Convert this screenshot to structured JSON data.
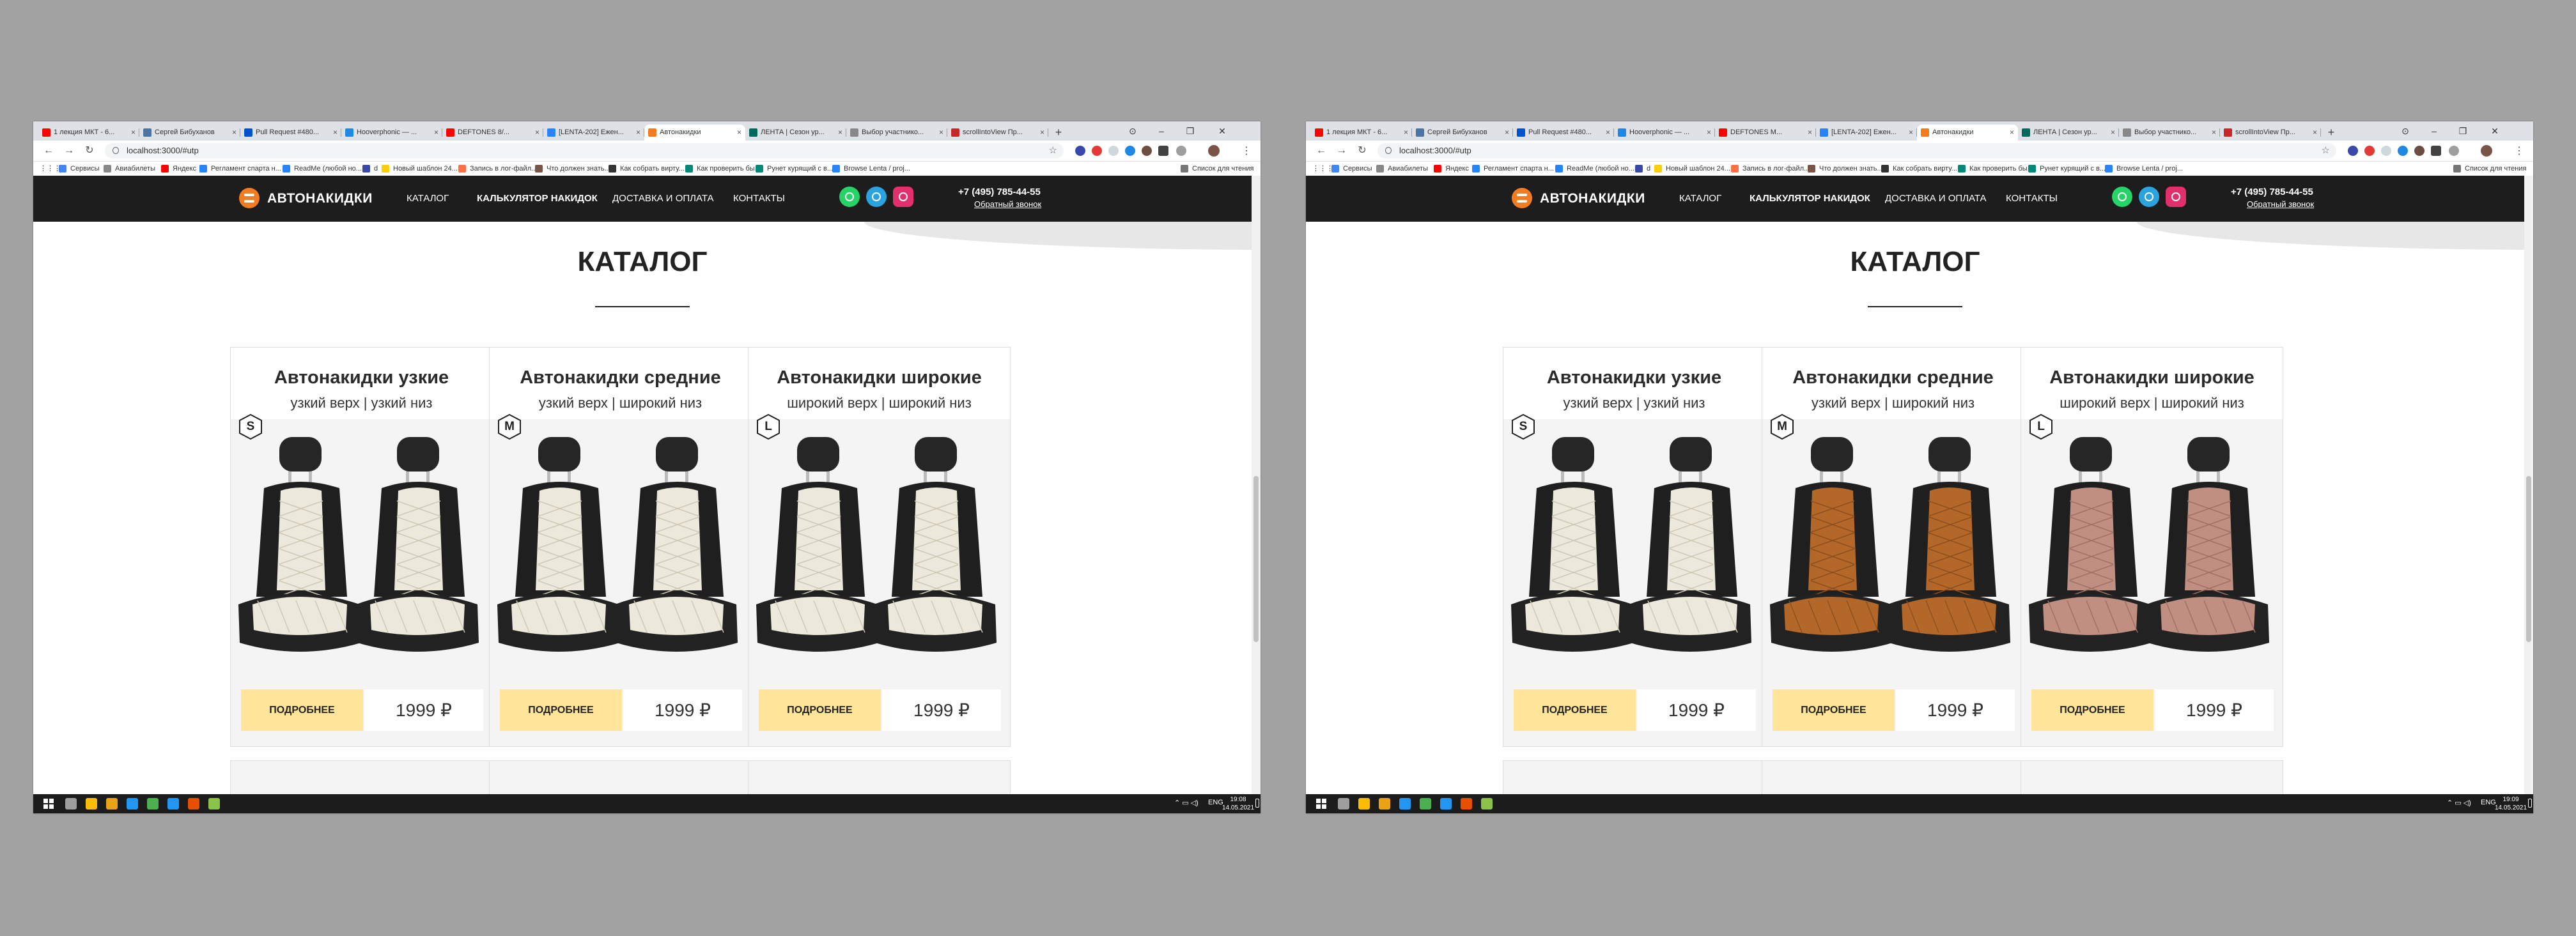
{
  "screens": [
    {
      "id": "left",
      "tabs": [
        {
          "title": "1 лекция МКТ - 6...",
          "fav": "#ff0000"
        },
        {
          "title": "Сергей Бибуханов",
          "fav": "#4c75a3"
        },
        {
          "title": "Pull Request #480...",
          "fav": "#0052cc"
        },
        {
          "title": "Hooverphonic — ...",
          "fav": "#1e88e5"
        },
        {
          "title": "DEFTONES 8/...",
          "fav": "#ff0000"
        },
        {
          "title": "[LENTA-202] Ежен...",
          "fav": "#2684ff"
        },
        {
          "title": "Автонакидки",
          "fav": "#f27c21",
          "active": true
        },
        {
          "title": "ЛЕНТА | Сезон ур...",
          "fav": "#00695c"
        },
        {
          "title": "Выбор участнико...",
          "fav": "#888888"
        },
        {
          "title": "scrollIntoView Пр...",
          "fav": "#c62828"
        }
      ],
      "url": "localhost:3000/#utp",
      "bookmarks": [
        {
          "label": "Сервисы",
          "color": "#4285f4"
        },
        {
          "label": "Авиабилеты",
          "color": "#888888"
        },
        {
          "label": "Яндекс",
          "color": "#ff0000"
        },
        {
          "label": "Регламент спарта н...",
          "color": "#2684ff"
        },
        {
          "label": "ReadMe (любой но...",
          "color": "#2684ff"
        },
        {
          "label": "d",
          "color": "#3949ab"
        },
        {
          "label": "Новый шаблон 24...",
          "color": "#ffcc00"
        },
        {
          "label": "Запись в лог-файл...",
          "color": "#ff7043"
        },
        {
          "label": "Что должен знать...",
          "color": "#795548"
        },
        {
          "label": "Как собрать вирту...",
          "color": "#333333"
        },
        {
          "label": "Как проверить бы...",
          "color": "#00897b"
        },
        {
          "label": "Рунет курящий с в...",
          "color": "#00897b"
        },
        {
          "label": "Browse Lenta / proj...",
          "color": "#2684ff"
        }
      ],
      "bookmarks_right": "Список для чтения",
      "site": {
        "logo": "АВТОНАКИДКИ",
        "nav": [
          "КАТАЛОГ",
          "КАЛЬКУЛЯТОР НАКИДОК",
          "ДОСТАВКА И ОПЛАТА",
          "КОНТАКТЫ"
        ],
        "phone": "+7 (495) 785-44-55",
        "callback": "Обратный звонок"
      },
      "section_title": "КАТАЛОГ",
      "products": [
        {
          "title": "Автонакидки узкие",
          "subtitle": "узкий верх | узкий низ",
          "size": "S",
          "button": "ПОДРОБНЕЕ",
          "price": "1999 ₽",
          "fabric": "#ece8db",
          "stitch": "#cfc8b4"
        },
        {
          "title": "Автонакидки средние",
          "subtitle": "узкий верх | широкий низ",
          "size": "M",
          "button": "ПОДРОБНЕЕ",
          "price": "1999 ₽",
          "fabric": "#ece8db",
          "stitch": "#cfc8b4"
        },
        {
          "title": "Автонакидки широкие",
          "subtitle": "широкий верх | широкий низ",
          "size": "L",
          "button": "ПОДРОБНЕЕ",
          "price": "1999 ₽",
          "fabric": "#ece8db",
          "stitch": "#cfc8b4"
        }
      ],
      "taskbar": {
        "lang": "ENG",
        "time": "19:08",
        "date": "14.05.2021"
      }
    },
    {
      "id": "right",
      "tabs": [
        {
          "title": "1 лекция МКТ - 6...",
          "fav": "#ff0000"
        },
        {
          "title": "Сергей Бибуханов",
          "fav": "#4c75a3"
        },
        {
          "title": "Pull Request #480...",
          "fav": "#0052cc"
        },
        {
          "title": "Hooverphonic — ...",
          "fav": "#1e88e5"
        },
        {
          "title": "DEFTONES M...",
          "fav": "#ff0000"
        },
        {
          "title": "[LENTA-202] Ежен...",
          "fav": "#2684ff"
        },
        {
          "title": "Автонакидки",
          "fav": "#f27c21",
          "active": true
        },
        {
          "title": "ЛЕНТА | Сезон ур...",
          "fav": "#00695c"
        },
        {
          "title": "Выбор участнико...",
          "fav": "#888888"
        },
        {
          "title": "scrollIntoView Пр...",
          "fav": "#c62828"
        }
      ],
      "url": "localhost:3000/#utp",
      "bookmarks": [
        {
          "label": "Сервисы",
          "color": "#4285f4"
        },
        {
          "label": "Авиабилеты",
          "color": "#888888"
        },
        {
          "label": "Яндекс",
          "color": "#ff0000"
        },
        {
          "label": "Регламент спарта н...",
          "color": "#2684ff"
        },
        {
          "label": "ReadMe (любой но...",
          "color": "#2684ff"
        },
        {
          "label": "d",
          "color": "#3949ab"
        },
        {
          "label": "Новый шаблон 24...",
          "color": "#ffcc00"
        },
        {
          "label": "Запись в лог-файл...",
          "color": "#ff7043"
        },
        {
          "label": "Что должен знать...",
          "color": "#795548"
        },
        {
          "label": "Как собрать вирту...",
          "color": "#333333"
        },
        {
          "label": "Как проверить бы...",
          "color": "#00897b"
        },
        {
          "label": "Рунет курящий с в...",
          "color": "#00897b"
        },
        {
          "label": "Browse Lenta / proj...",
          "color": "#2684ff"
        }
      ],
      "bookmarks_right": "Список для чтения",
      "site": {
        "logo": "АВТОНАКИДКИ",
        "nav": [
          "КАТАЛОГ",
          "КАЛЬКУЛЯТОР НАКИДОК",
          "ДОСТАВКА И ОПЛАТА",
          "КОНТАКТЫ"
        ],
        "phone": "+7 (495) 785-44-55",
        "callback": "Обратный звонок"
      },
      "section_title": "КАТАЛОГ",
      "products": [
        {
          "title": "Автонакидки узкие",
          "subtitle": "узкий верх | узкий низ",
          "size": "S",
          "button": "ПОДРОБНЕЕ",
          "price": "1999 ₽",
          "fabric": "#ece8db",
          "stitch": "#cfc8b4"
        },
        {
          "title": "Автонакидки средние",
          "subtitle": "узкий верх | широкий низ",
          "size": "M",
          "button": "ПОДРОБНЕЕ",
          "price": "1999 ₽",
          "fabric": "#b3682a",
          "stitch": "#8d4f1d"
        },
        {
          "title": "Автонакидки широкие",
          "subtitle": "широкий верх | широкий низ",
          "size": "L",
          "button": "ПОДРОБНЕЕ",
          "price": "1999 ₽",
          "fabric": "#c08f82",
          "stitch": "#9f7064"
        }
      ],
      "taskbar": {
        "lang": "ENG",
        "time": "19:09",
        "date": "14.05.2021"
      }
    }
  ]
}
